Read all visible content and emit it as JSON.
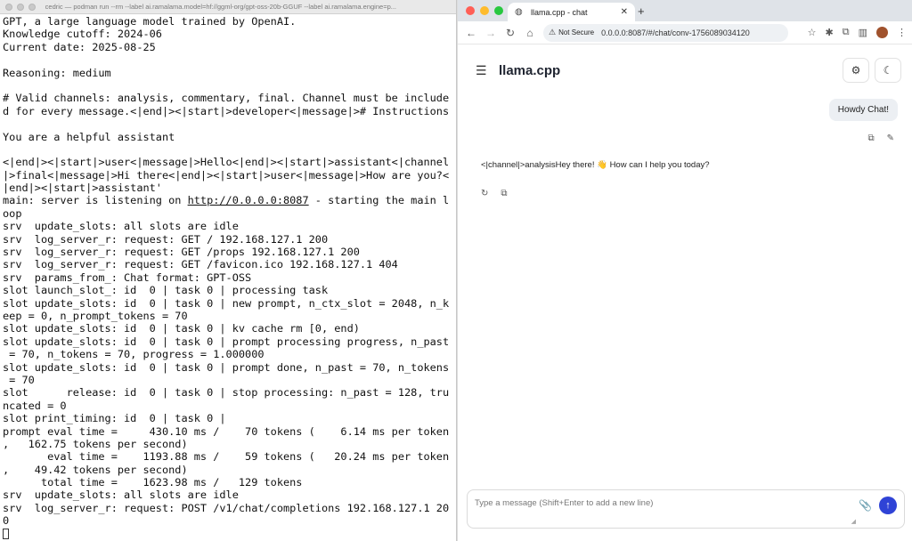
{
  "terminal": {
    "title": "cedric — podman run --rm --label ai.ramalama.model=hf://ggml-org/gpt-oss-20b-GGUF --label ai.ramalama.engine=p...",
    "lines": [
      "GPT, a large language model trained by OpenAI.",
      "Knowledge cutoff: 2024-06",
      "Current date: 2025-08-25",
      "",
      "Reasoning: medium",
      "",
      "# Valid channels: analysis, commentary, final. Channel must be include",
      "d for every message.<|end|><|start|>developer<|message|># Instructions",
      "",
      "You are a helpful assistant",
      "",
      "<|end|><|start|>user<|message|>Hello<|end|><|start|>assistant<|channel",
      "|>final<|message|>Hi there<|end|><|start|>user<|message|>How are you?<",
      "|end|><|start|>assistant'",
      "main: server is listening on http://0.0.0.0:8087 - starting the main l",
      "oop",
      "srv  update_slots: all slots are idle",
      "srv  log_server_r: request: GET / 192.168.127.1 200",
      "srv  log_server_r: request: GET /props 192.168.127.1 200",
      "srv  log_server_r: request: GET /favicon.ico 192.168.127.1 404",
      "srv  params_from_: Chat format: GPT-OSS",
      "slot launch_slot_: id  0 | task 0 | processing task",
      "slot update_slots: id  0 | task 0 | new prompt, n_ctx_slot = 2048, n_k",
      "eep = 0, n_prompt_tokens = 70",
      "slot update_slots: id  0 | task 0 | kv cache rm [0, end)",
      "slot update_slots: id  0 | task 0 | prompt processing progress, n_past",
      " = 70, n_tokens = 70, progress = 1.000000",
      "slot update_slots: id  0 | task 0 | prompt done, n_past = 70, n_tokens",
      " = 70",
      "slot      release: id  0 | task 0 | stop processing: n_past = 128, tru",
      "ncated = 0",
      "slot print_timing: id  0 | task 0 |",
      "prompt eval time =     430.10 ms /    70 tokens (    6.14 ms per token",
      ",   162.75 tokens per second)",
      "       eval time =    1193.88 ms /    59 tokens (   20.24 ms per token",
      ",    49.42 tokens per second)",
      "      total time =    1623.98 ms /   129 tokens",
      "srv  update_slots: all slots are idle",
      "srv  log_server_r: request: POST /v1/chat/completions 192.168.127.1 20",
      "0"
    ],
    "url_part": "http://0.0.0.0:8087"
  },
  "browser": {
    "tab_title": "llama.cpp - chat",
    "not_secure": "Not Secure",
    "url": "0.0.0.0:8087/#/chat/conv-1756089034120",
    "app_title": "llama.cpp",
    "user_message": "Howdy Chat!",
    "assistant_message": "<|channel|>analysisHey there! 👋 How can I help you today?",
    "composer_placeholder": "Type a message (Shift+Enter to add a new line)"
  }
}
